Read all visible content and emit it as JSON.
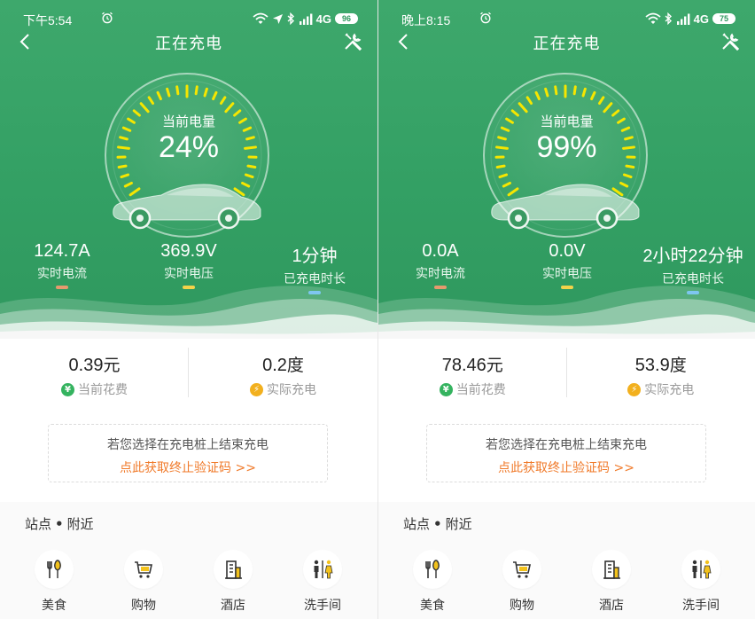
{
  "colors": {
    "green": "#3ea86c",
    "tick_yellow": "#f6e600",
    "dash_current": "#e59a6e",
    "dash_voltage": "#f3d34a",
    "dash_duration": "#7ec6f0",
    "coin_green": "#34b35f",
    "coin_yellow": "#f2b01e",
    "link_orange": "#f07a2a"
  },
  "screens": [
    {
      "status": {
        "time": "下午5:54",
        "network": "4G",
        "battery": "96"
      },
      "nav": {
        "title": "正在充电",
        "back_icon": "back-chevron-icon",
        "tools_icon": "wrench-screwdriver-icon"
      },
      "gauge": {
        "label": "当前电量",
        "value": "24%",
        "level": 0.24
      },
      "metrics": [
        {
          "value": "124.7A",
          "label": "实时电流"
        },
        {
          "value": "369.9V",
          "label": "实时电压"
        },
        {
          "value": "1分钟",
          "label": "已充电时长"
        }
      ],
      "cost": {
        "amount": "0.39",
        "amount_unit": "元",
        "amount_label": "当前花费",
        "amount_icon": "¥",
        "energy": "0.2",
        "energy_unit": "度",
        "energy_label": "实际充电",
        "energy_icon": "⚡"
      },
      "notice": {
        "text": "若您选择在充电桩上结束充电",
        "link": "点此获取终止验证码 >>"
      },
      "nearby": {
        "title_a": "站点",
        "separator": "•",
        "title_b": "附近",
        "items": [
          {
            "label": "美食",
            "icon": "fork-knife-icon"
          },
          {
            "label": "购物",
            "icon": "shopping-cart-icon"
          },
          {
            "label": "酒店",
            "icon": "hotel-building-icon"
          },
          {
            "label": "洗手间",
            "icon": "restroom-icon"
          }
        ]
      }
    },
    {
      "status": {
        "time": "晚上8:15",
        "network": "4G",
        "battery": "75"
      },
      "nav": {
        "title": "正在充电",
        "back_icon": "back-chevron-icon",
        "tools_icon": "wrench-screwdriver-icon"
      },
      "gauge": {
        "label": "当前电量",
        "value": "99%",
        "level": 0.99
      },
      "metrics": [
        {
          "value": "0.0A",
          "label": "实时电流"
        },
        {
          "value": "0.0V",
          "label": "实时电压"
        },
        {
          "value": "2小时22分钟",
          "label": "已充电时长"
        }
      ],
      "cost": {
        "amount": "78.46",
        "amount_unit": "元",
        "amount_label": "当前花费",
        "amount_icon": "¥",
        "energy": "53.9",
        "energy_unit": "度",
        "energy_label": "实际充电",
        "energy_icon": "⚡"
      },
      "notice": {
        "text": "若您选择在充电桩上结束充电",
        "link": "点此获取终止验证码 >>"
      },
      "nearby": {
        "title_a": "站点",
        "separator": "•",
        "title_b": "附近",
        "items": [
          {
            "label": "美食",
            "icon": "fork-knife-icon"
          },
          {
            "label": "购物",
            "icon": "shopping-cart-icon"
          },
          {
            "label": "酒店",
            "icon": "hotel-building-icon"
          },
          {
            "label": "洗手间",
            "icon": "restroom-icon"
          }
        ]
      }
    }
  ]
}
